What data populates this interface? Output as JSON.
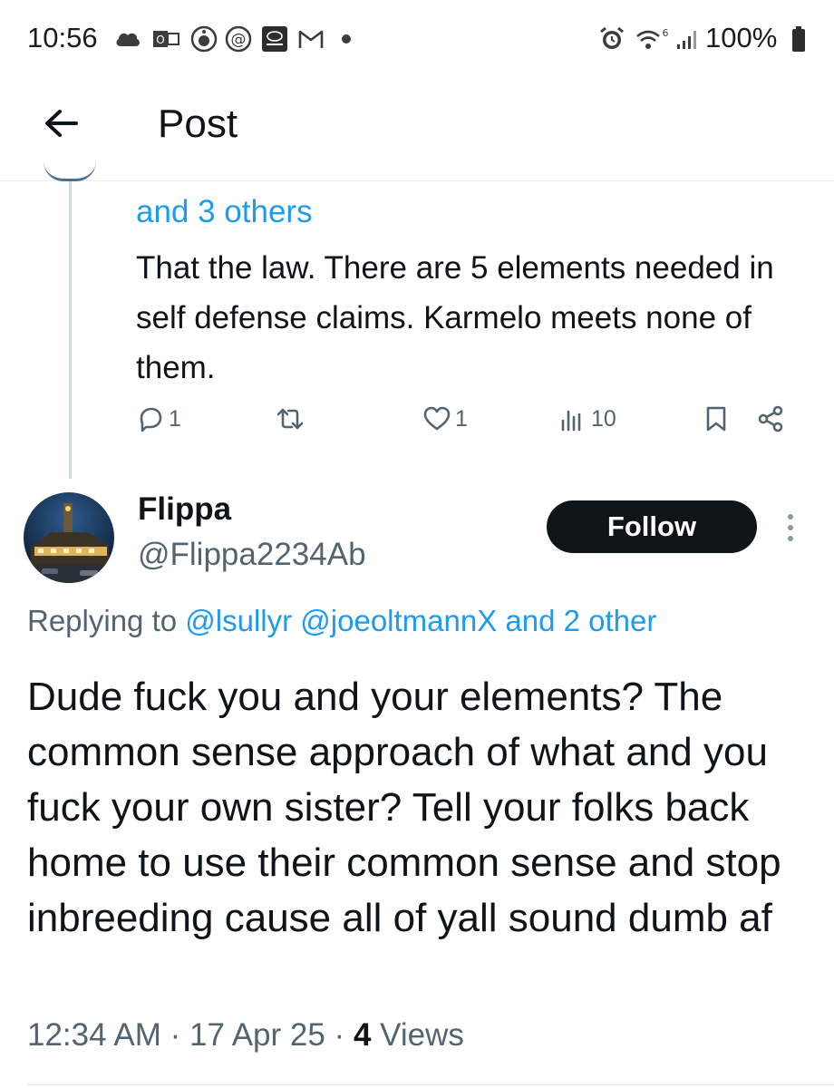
{
  "status_bar": {
    "time": "10:56",
    "battery_percent": "100%"
  },
  "header": {
    "title": "Post"
  },
  "parent_tweet": {
    "others_link": "and 3 others",
    "text": "That the law. There are 5 elements needed in self defense claims. Karmelo meets none of them.",
    "reply_count": "1",
    "like_count": "1",
    "view_count": "10"
  },
  "reply_tweet": {
    "display_name": "Flippa",
    "handle": "@Flippa2234Ab",
    "follow_label": "Follow",
    "replying_prefix": "Replying to",
    "replying_mentions": "@lsullyr @joeoltmannX and 2 other",
    "text": "Dude fuck you and your elements? The common sense approach of what and you fuck your own sister? Tell your folks back home to use their common sense and stop inbreeding cause all of yall sound dumb af",
    "timestamp": "12:34 AM · 17 Apr 25 · ",
    "views_count": "4",
    "views_label": " Views"
  },
  "colors": {
    "accent_blue": "#1d9bf0",
    "text_primary": "#0f1419",
    "text_secondary": "#536471",
    "follow_bg": "#0f1419"
  }
}
